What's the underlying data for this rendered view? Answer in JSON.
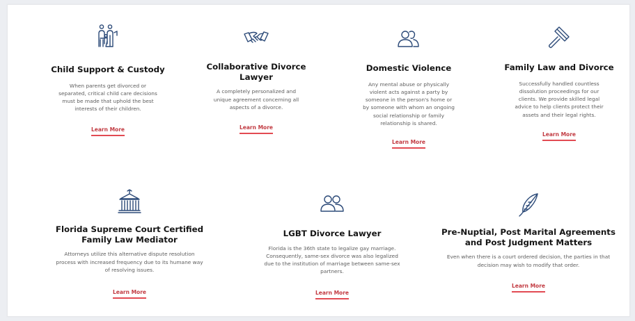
{
  "accent_color": "#e24a52",
  "icon_color": "#2c4a78",
  "services": [
    {
      "icon": "family-icon",
      "title": "Child Support & Custody",
      "description": "When parents get divorced or separated, critical child care decisions must be made that uphold the best interests of their children.",
      "link": "Learn More"
    },
    {
      "icon": "handshake-icon",
      "title": "Collaborative Divorce Lawyer",
      "description": "A completely personalized and unique agreement concerning all aspects of a divorce.",
      "link": "Learn More"
    },
    {
      "icon": "people-icon",
      "title": "Domestic Violence",
      "description": "Any mental abuse or physically violent acts against a party by someone in the person's home or by someone with whom an ongoing social relationship or family relationship is shared.",
      "link": "Learn More"
    },
    {
      "icon": "gavel-icon",
      "title": "Family Law and Divorce",
      "description": "Successfully handled countless dissolution proceedings for our clients. We provide skilled legal advice to help clients protect their assets and their legal rights.",
      "link": "Learn More"
    },
    {
      "icon": "courthouse-icon",
      "title": "Florida Supreme Court Certified Family Law Mediator",
      "description": "Attorneys utilize this alternative dispute resolution process with increased frequency due to its humane way of resolving issues.",
      "link": "Learn More"
    },
    {
      "icon": "people-icon",
      "title": "LGBT Divorce Lawyer",
      "description": "Florida is the 36th state to legalize gay marriage. Consequently, same-sex divorce was also legalized due to the institution of marriage between same-sex partners.",
      "link": "Learn More"
    },
    {
      "icon": "quill-icon",
      "title": "Pre-Nuptial, Post Marital Agreements and Post Judgment Matters",
      "description": "Even when there is a court ordered decision, the parties in that decision may wish to modify that order.",
      "link": "Learn More"
    }
  ]
}
